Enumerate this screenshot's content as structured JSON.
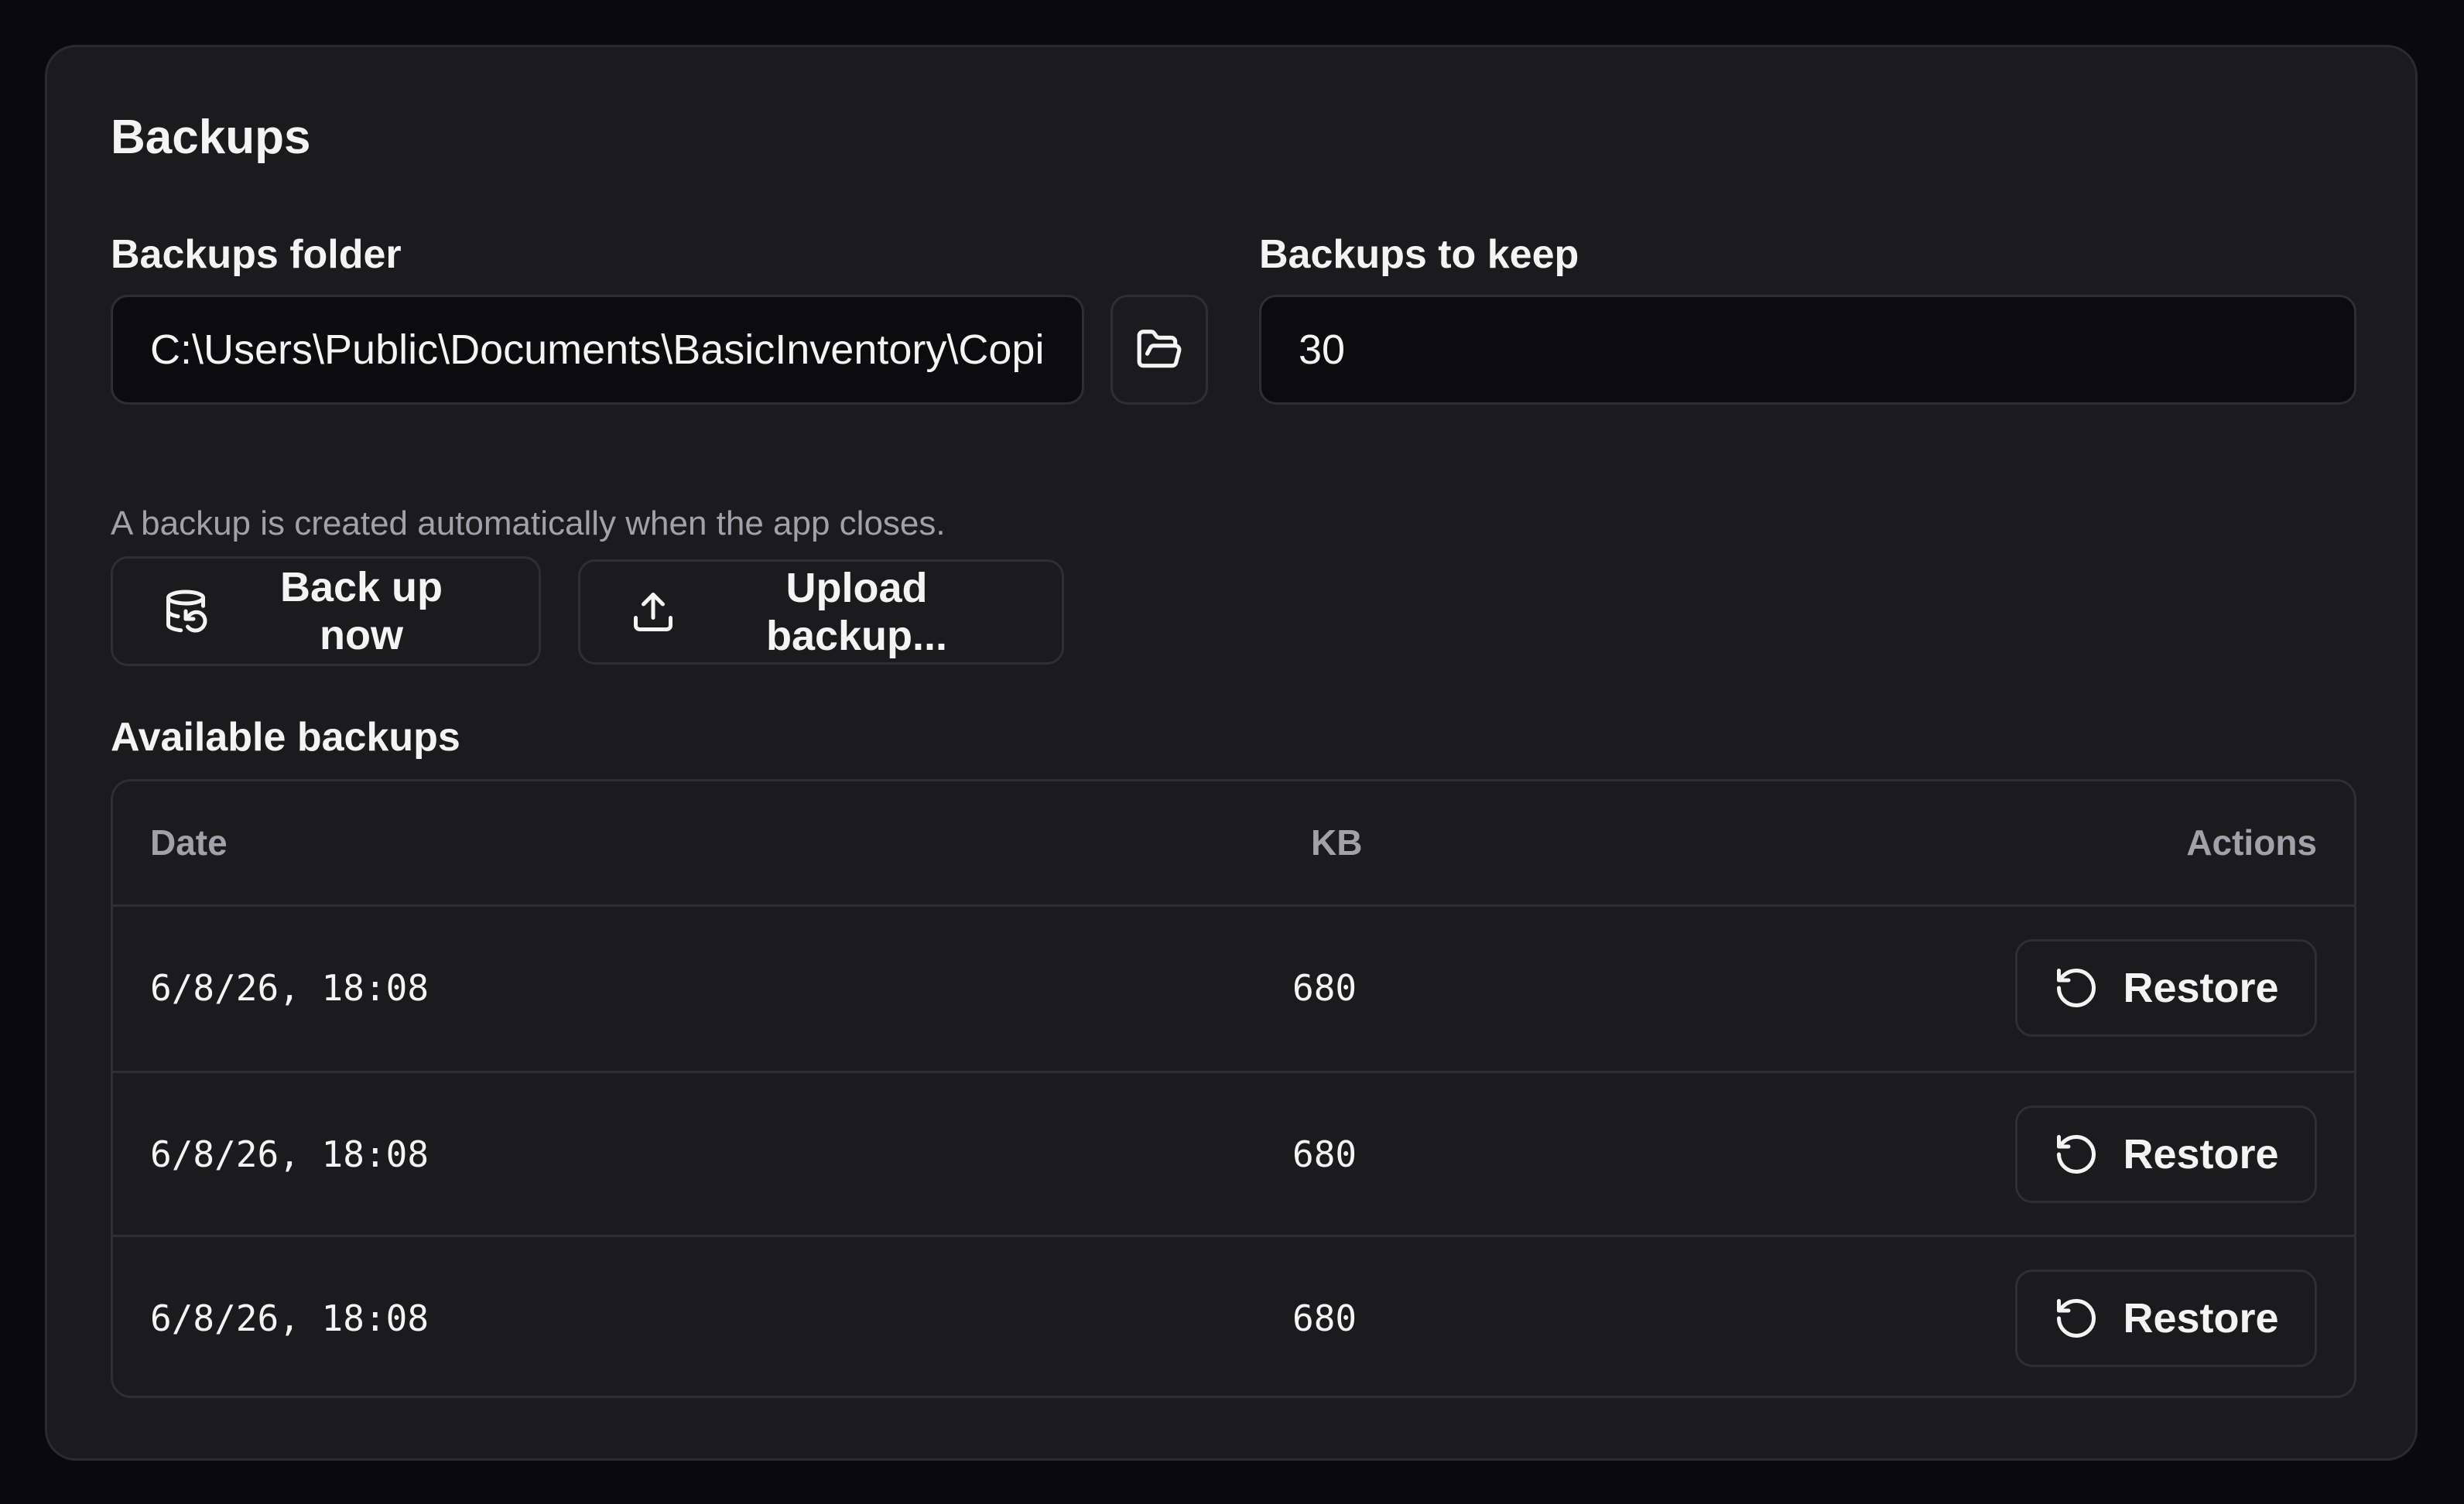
{
  "section": {
    "title": "Backups"
  },
  "folder": {
    "label": "Backups folder",
    "value": "C:\\Users\\Public\\Documents\\BasicInventory\\Copies",
    "browse_icon": "folder-open-icon"
  },
  "keep": {
    "label": "Backups to keep",
    "value": "30"
  },
  "hint": "A backup is created automatically when the app closes.",
  "actions": {
    "backup_now": {
      "label": "Back up now",
      "icon": "database-backup-icon"
    },
    "upload": {
      "label": "Upload backup...",
      "icon": "upload-icon"
    }
  },
  "available": {
    "title": "Available backups",
    "columns": {
      "date": "Date",
      "kb": "KB",
      "actions": "Actions"
    },
    "rows": [
      {
        "date": "6/8/26, 18:08",
        "kb": "680",
        "action": "Restore"
      },
      {
        "date": "6/8/26, 18:08",
        "kb": "680",
        "action": "Restore"
      },
      {
        "date": "6/8/26, 18:08",
        "kb": "680",
        "action": "Restore"
      }
    ],
    "restore_icon": "rotate-ccw-icon"
  },
  "colors": {
    "background": "#0a0a0c",
    "card": "#1b1b1e",
    "border": "#2e2e33",
    "input_bg": "#0c0c0e",
    "text": "#f4f4f5",
    "muted": "#a1a1aa"
  }
}
